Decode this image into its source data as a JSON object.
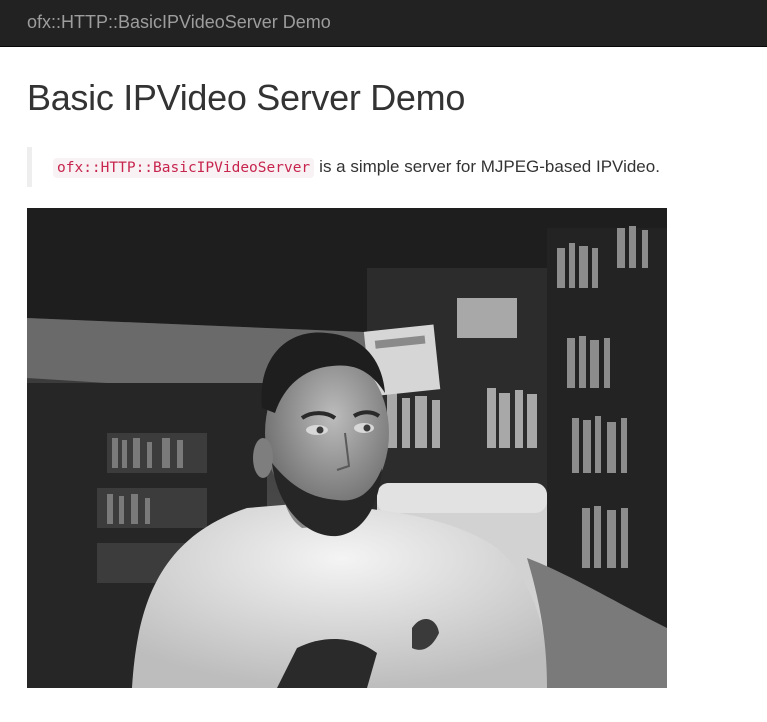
{
  "navbar": {
    "brand": "ofx::HTTP::BasicIPVideoServer Demo"
  },
  "page": {
    "title": "Basic IPVideo Server Demo"
  },
  "description": {
    "code": "ofx::HTTP::BasicIPVideoServer",
    "text": "is a simple server for MJPEG-based IPVideo."
  },
  "video": {
    "kind": "live MJPEG camera stream",
    "tone": "grayscale"
  }
}
